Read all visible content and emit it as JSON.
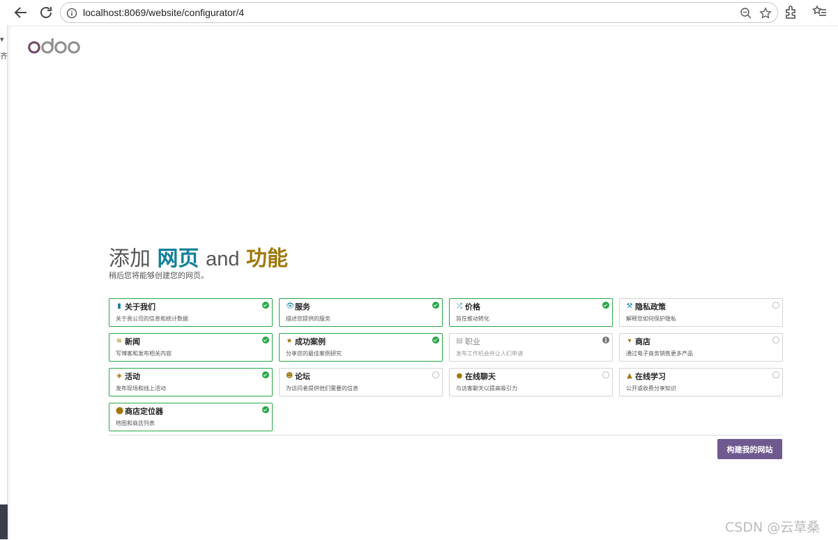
{
  "browser": {
    "url": "localhost:8069/website/configurator/4"
  },
  "side_fragment": {
    "char1": "▾",
    "char2": "齐"
  },
  "page": {
    "heading_prefix": "添加",
    "heading_word1": "网页",
    "heading_and": "and",
    "heading_word2": "功能",
    "subtitle": "稍后您将能够创建您的网页。",
    "build_button": "构建我的网站",
    "colors": {
      "accent_teal": "#0f7f99",
      "accent_gold": "#a07707",
      "selected_border": "#28a745",
      "button": "#6e5a8f"
    }
  },
  "features": [
    {
      "icon": "bookmark-icon",
      "glyph": "▮",
      "color": "#0f7f99",
      "title": "关于我们",
      "desc": "关于贵公司的信息和统计数据",
      "state": "selected"
    },
    {
      "icon": "handshake-icon",
      "glyph": "👁",
      "color": "#0f7f99",
      "title": "服务",
      "desc": "描述您提供的服务",
      "state": "selected"
    },
    {
      "icon": "random-icon",
      "glyph": "⤮",
      "color": "#0f7f99",
      "title": "价格",
      "desc": "旨在推动转化",
      "state": "selected"
    },
    {
      "icon": "gavel-icon",
      "glyph": "⚒",
      "color": "#0f7f99",
      "title": "隐私政策",
      "desc": "解释您如何保护隐私",
      "state": "unselected"
    },
    {
      "icon": "rss-icon",
      "glyph": "≋",
      "color": "#a07707",
      "title": "新闻",
      "desc": "写博客和发布相关内容",
      "state": "selected"
    },
    {
      "icon": "star-icon",
      "glyph": "★",
      "color": "#a07707",
      "title": "成功案例",
      "desc": "分享您的最佳案例研究",
      "state": "selected"
    },
    {
      "icon": "id-card-icon",
      "glyph": "▤",
      "color": "#999999",
      "title": "职业",
      "desc": "发布工作机会并让人们申请",
      "state": "disabled"
    },
    {
      "icon": "shopping-cart-icon",
      "glyph": "▾",
      "color": "#a07707",
      "title": "商店",
      "desc": "通过电子商务销售更多产品",
      "state": "unselected"
    },
    {
      "icon": "ticket-icon",
      "glyph": "◈",
      "color": "#a07707",
      "title": "活动",
      "desc": "发布现场和线上活动",
      "state": "selected"
    },
    {
      "icon": "users-icon",
      "glyph": "☻",
      "color": "#a07707",
      "title": "论坛",
      "desc": "为访问者提供他们需要的信息",
      "state": "unselected"
    },
    {
      "icon": "comments-icon",
      "glyph": "●",
      "color": "#a07707",
      "title": "在线聊天",
      "desc": "与访客聊天以提高吸引力",
      "state": "unselected"
    },
    {
      "icon": "graduation-cap-icon",
      "glyph": "▲",
      "color": "#a07707",
      "title": "在线学习",
      "desc": "公开或收费分享知识",
      "state": "unselected"
    },
    {
      "icon": "map-marker-icon",
      "glyph": "⬤",
      "color": "#a07707",
      "title": "商店定位器",
      "desc": "地图和商店列表",
      "state": "selected"
    }
  ],
  "watermark": "CSDN @云草桑"
}
